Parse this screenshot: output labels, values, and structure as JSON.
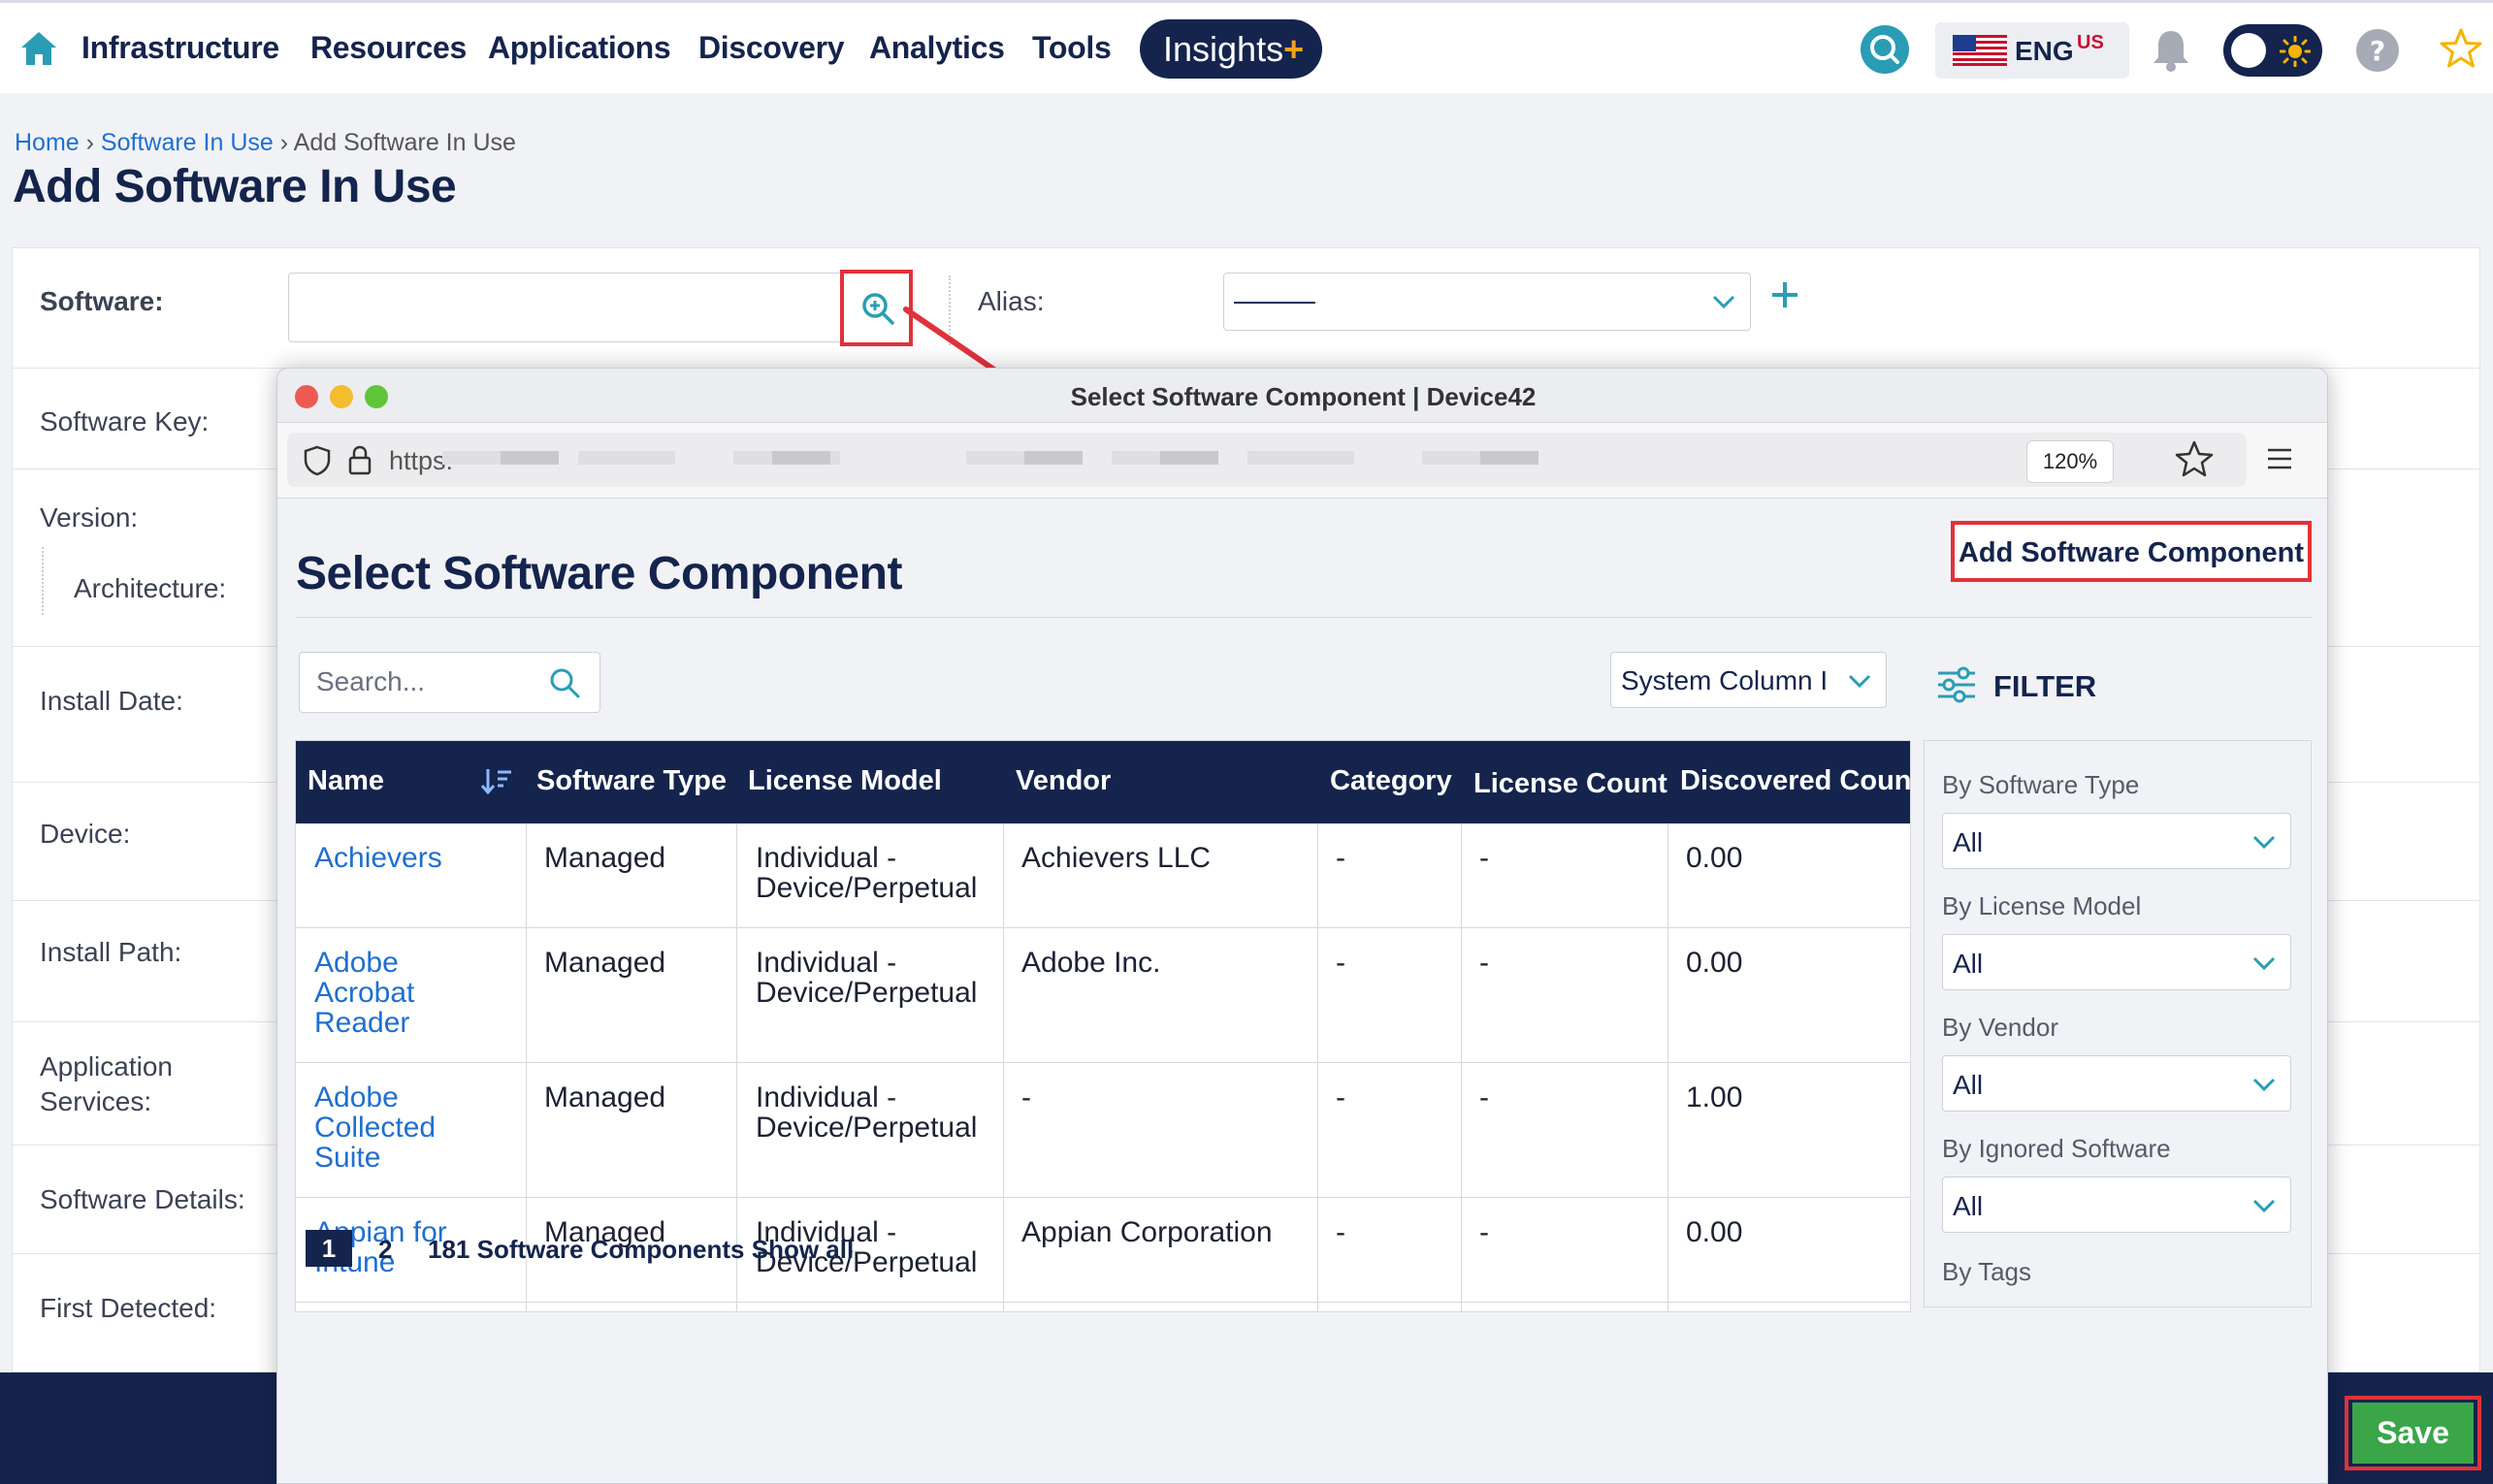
{
  "nav": {
    "items": [
      "Infrastructure",
      "Resources",
      "Applications",
      "Discovery",
      "Analytics",
      "Tools"
    ],
    "insights_label": "Insights",
    "insights_plus": "+",
    "lang_code": "ENG",
    "lang_region": "US"
  },
  "breadcrumb": {
    "home": "Home",
    "sep": "›",
    "parent": "Software In Use",
    "current": "Add Software In Use"
  },
  "page_title": "Add Software In Use",
  "form": {
    "software_label": "Software:",
    "alias_label": "Alias:",
    "alias_value": "———",
    "software_key_label": "Software Key:",
    "version_label": "Version:",
    "architecture_label": "Architecture:",
    "install_date_label": "Install Date:",
    "device_label": "Device:",
    "install_path_label": "Install Path:",
    "application_services_label_1": "Application",
    "application_services_label_2": "Services:",
    "software_details_label": "Software Details:",
    "first_detected_label": "First Detected:"
  },
  "save_label": "Save",
  "popup": {
    "window_title": "Select Software Component | Device42",
    "url_prefix": "https:",
    "zoom": "120%",
    "title": "Select Software Component",
    "add_button": "Add Software Component",
    "search_placeholder": "Search...",
    "column_select": "System Column I",
    "filter_label": "FILTER",
    "columns": [
      "Name",
      "Software Type",
      "License Model",
      "Vendor",
      "Category",
      "License Count",
      "Discovered Coun"
    ],
    "rows": [
      {
        "name": [
          "Achievers"
        ],
        "type": "Managed",
        "license": [
          "Individual -",
          "Device/Perpetual"
        ],
        "vendor": "Achievers LLC",
        "category": "-",
        "count": "-",
        "discovered": "0.00"
      },
      {
        "name": [
          "Adobe",
          "Acrobat",
          "Reader"
        ],
        "type": "Managed",
        "license": [
          "Individual -",
          "Device/Perpetual"
        ],
        "vendor": "Adobe Inc.",
        "category": "-",
        "count": "-",
        "discovered": "0.00"
      },
      {
        "name": [
          "Adobe",
          "Collected",
          "Suite"
        ],
        "type": "Managed",
        "license": [
          "Individual -",
          "Device/Perpetual"
        ],
        "vendor": "-",
        "category": "-",
        "count": "-",
        "discovered": "1.00"
      },
      {
        "name": [
          "Appian for",
          "Intune"
        ],
        "type": "Managed",
        "license": [
          "Individual -",
          "Device/Perpetual"
        ],
        "vendor": "Appian Corporation",
        "category": "-",
        "count": "-",
        "discovered": "0.00"
      }
    ],
    "filters": [
      {
        "label": "By Software Type",
        "value": "All"
      },
      {
        "label": "By License Model",
        "value": "All"
      },
      {
        "label": "By Vendor",
        "value": "All"
      },
      {
        "label": "By Ignored Software",
        "value": "All"
      }
    ],
    "filter_tags_label": "By Tags",
    "pager": {
      "page1": "1",
      "page2": "2",
      "summary": "181 Software Components Show all"
    }
  },
  "colors": {
    "navy": "#14244d",
    "link": "#1f6fd0",
    "highlight": "#e0323a",
    "save": "#3ba54a",
    "teal": "#2a9db5"
  }
}
